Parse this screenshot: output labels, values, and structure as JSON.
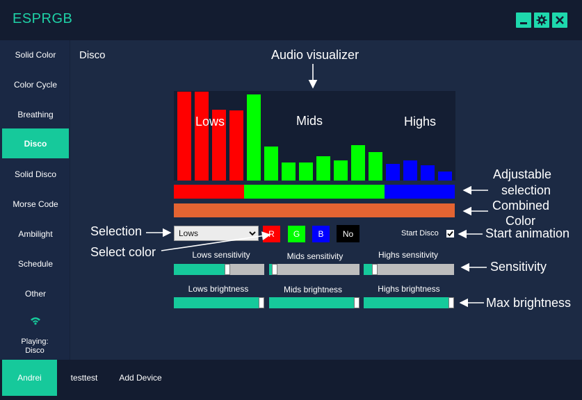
{
  "app": {
    "title": "ESPRGB",
    "controls": [
      "minimize-icon",
      "gear-icon",
      "close-icon"
    ]
  },
  "sidebar": {
    "items": [
      {
        "label": "Solid Color"
      },
      {
        "label": "Color Cycle"
      },
      {
        "label": "Breathing"
      },
      {
        "label": "Disco",
        "active": true
      },
      {
        "label": "Solid Disco"
      },
      {
        "label": "Morse Code"
      },
      {
        "label": "Ambilight"
      },
      {
        "label": "Schedule"
      },
      {
        "label": "Other"
      }
    ],
    "status_icon": "wifi-icon",
    "playing_line1": "Playing:",
    "playing_line2": "Disco"
  },
  "footer": {
    "devices": [
      {
        "label": "Andrei",
        "active": true
      },
      {
        "label": "testtest"
      },
      {
        "label": "Add Device"
      }
    ]
  },
  "main": {
    "title": "Disco",
    "visualizer": {
      "bands": [
        {
          "label": "Lows",
          "color": "#ff0000",
          "levels": [
            1.0,
            1.0,
            0.8,
            0.79
          ]
        },
        {
          "label": "Mids",
          "color": "#00ff00",
          "levels": [
            0.97,
            0.38,
            0.2,
            0.2,
            0.27,
            0.23,
            0.4,
            0.32
          ]
        },
        {
          "label": "Highs",
          "color": "#0000ff",
          "levels": [
            0.19,
            0.23,
            0.17,
            0.1
          ]
        }
      ]
    },
    "selection_bar": [
      {
        "color": "#ff0000",
        "fraction": 0.25
      },
      {
        "color": "#00ff00",
        "fraction": 0.5
      },
      {
        "color": "#0000ff",
        "fraction": 0.25
      }
    ],
    "combined_color": "#e46432",
    "band_select": {
      "value": "Lows",
      "options": [
        "Lows"
      ]
    },
    "color_buttons": [
      {
        "label": "R",
        "color": "#ff0000"
      },
      {
        "label": "G",
        "color": "#00ff00"
      },
      {
        "label": "B",
        "color": "#0000ff"
      }
    ],
    "no_button": "No",
    "start_disco": {
      "label": "Start Disco",
      "checked": true
    },
    "sensitivity": [
      {
        "label": "Lows sensitivity",
        "value": 0.6
      },
      {
        "label": "Mids sensitivity",
        "value": 0.03
      },
      {
        "label": "Highs sensitivity",
        "value": 0.1
      }
    ],
    "brightness": [
      {
        "label": "Lows brightness",
        "value": 1.0
      },
      {
        "label": "Mids brightness",
        "value": 1.0
      },
      {
        "label": "Highs brightness",
        "value": 1.0
      }
    ]
  },
  "annotations": {
    "audio_visualizer": "Audio visualizer",
    "adjustable_selection_1": "Adjustable",
    "adjustable_selection_2": "selection",
    "combined_color_1": "Combined",
    "combined_color_2": "Color",
    "selection": "Selection",
    "select_color": "Select color",
    "start_animation": "Start animation",
    "sensitivity": "Sensitivity",
    "max_brightness": "Max brightness"
  }
}
